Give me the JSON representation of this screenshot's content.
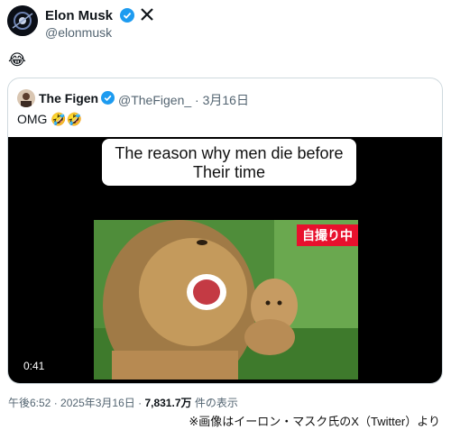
{
  "author": {
    "name": "Elon Musk",
    "handle": "@elonmusk",
    "verified_icon": "verified-badge-icon",
    "platform_icon": "x-logo-icon"
  },
  "tweet": {
    "text": "😂"
  },
  "quoted": {
    "name": "The Figen",
    "handle": "@TheFigen_",
    "separator": "·",
    "date": "3月16日",
    "text": "OMG 🤣🤣",
    "video": {
      "caption_line1": "The reason why men die before",
      "caption_line2": "Their time",
      "stamp": "自撮り中",
      "duration": "0:41"
    }
  },
  "meta": {
    "time": "午後6:52",
    "separator": "·",
    "date": "2025年3月16日",
    "views_count": "7,831.7万",
    "views_label": "件の表示"
  },
  "credit": "※画像はイーロン・マスク氏のX（Twitter）より",
  "colors": {
    "brand_blue": "#1d9bf0",
    "stamp_red": "#e8112d",
    "muted": "#536471"
  }
}
